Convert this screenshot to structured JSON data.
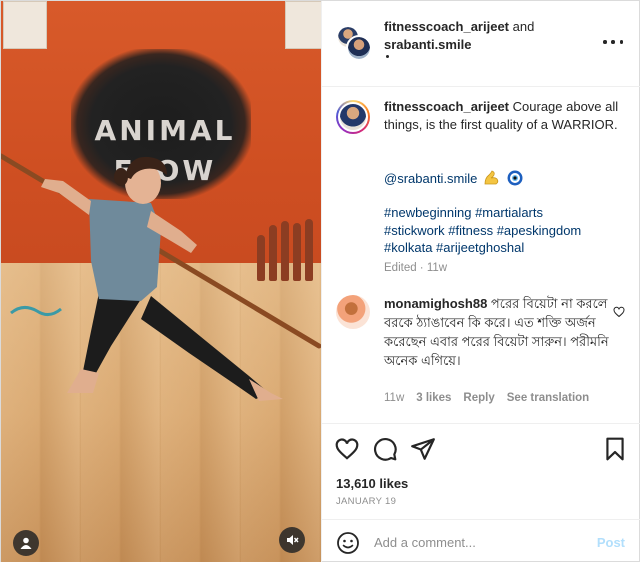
{
  "post": {
    "header": {
      "user1": "fitnesscoach_arijeet",
      "and": "and",
      "user2": "srabanti.smile",
      "dot": "•"
    },
    "caption": {
      "username": "fitnesscoach_arijeet",
      "text": "Courage above all things, is the first quality of a WARRIOR.",
      "mention": "@srabanti.smile",
      "tags_line1": "#newbeginning #martialarts",
      "tags_line2": "#stickwork #fitness #apeskingdom",
      "tags_line3": "#kolkata #arijeetghoshal",
      "edited": "Edited · 11w"
    },
    "comment": {
      "username": "monamighosh88",
      "text": "পরের বিয়েটা না করলে বরকে ঠ্যাঙাবেন কি করে। এত শক্তি অর্জন করেছেন এবার পরের বিয়েটা সারুন। পরীমনি অনেক এগিয়ে।",
      "time": "11w",
      "likes": "3 likes",
      "reply": "Reply",
      "translate": "See translation"
    },
    "likes": "13,610 likes",
    "date": "JANUARY 19",
    "add_comment": {
      "placeholder": "Add a comment...",
      "post": "Post"
    },
    "media": {
      "wall_text": "ANIMAL FLOW"
    }
  },
  "colors": {
    "link": "#00376b",
    "muted": "#8e8e8e",
    "post_disabled": "#b2dffc",
    "wall": "#d85a2a"
  },
  "icons": [
    "more-icon",
    "heart-icon",
    "comment-icon",
    "share-icon",
    "bookmark-icon",
    "emoji-icon",
    "user-tag-icon",
    "mute-icon",
    "muscle-emoji-icon",
    "nazar-emoji-icon"
  ]
}
